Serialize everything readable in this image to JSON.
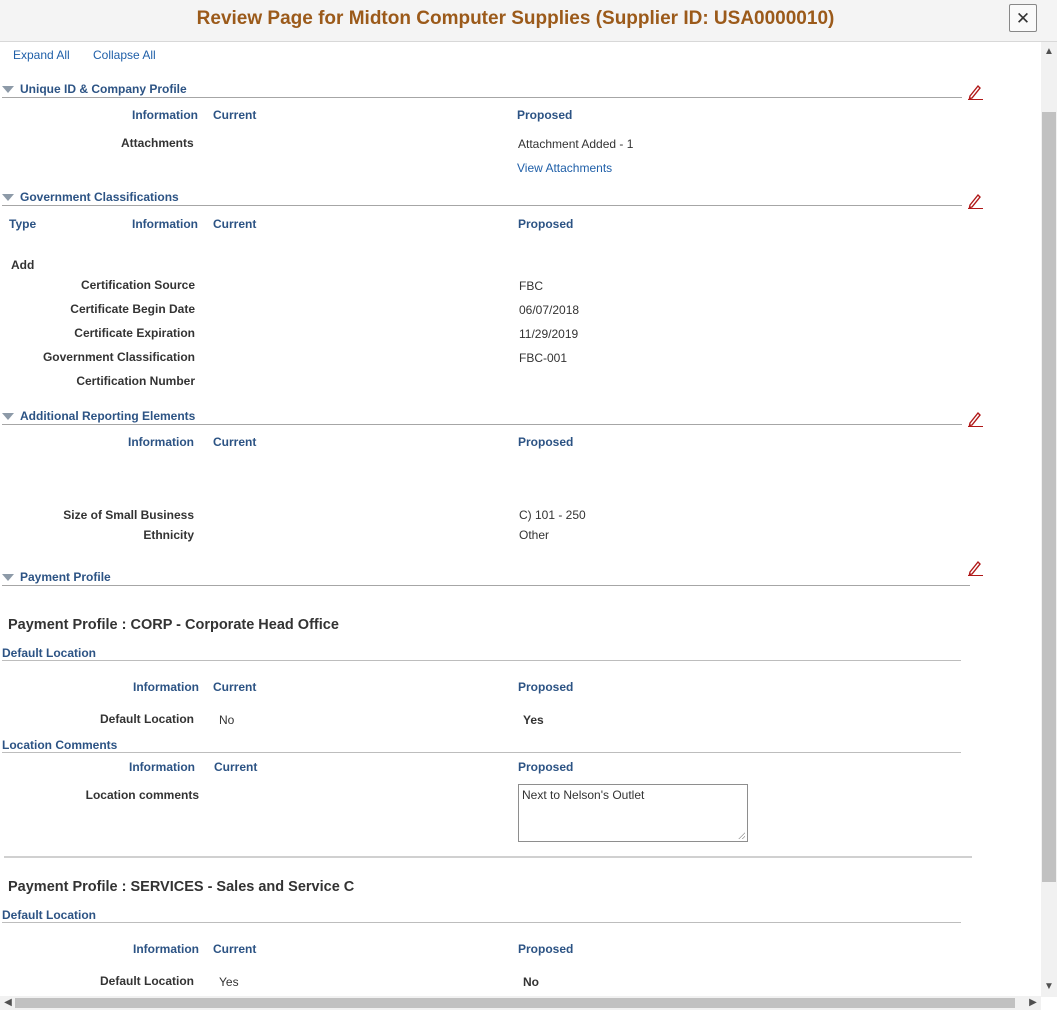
{
  "window": {
    "title": "Review Page for Midton Computer Supplies (Supplier ID: USA0000010)",
    "close_icon": "close-icon",
    "close_glyph": "✕"
  },
  "toolbar": {
    "expand_all": "Expand All",
    "collapse_all": "Collapse All"
  },
  "columns": {
    "type": "Type",
    "information": "Information",
    "current": "Current",
    "proposed": "Proposed"
  },
  "sections": {
    "unique_id": {
      "title": "Unique ID & Company Profile",
      "rows": [
        {
          "label": "Attachments",
          "current": "",
          "proposed": "Attachment Added - 1"
        }
      ],
      "view_attachments": "View Attachments"
    },
    "gov": {
      "title": "Government Classifications",
      "type_value": "Add",
      "rows": [
        {
          "label": "Certification Source",
          "current": "",
          "proposed": "FBC"
        },
        {
          "label": "Certificate Begin Date",
          "current": "",
          "proposed": "06/07/2018"
        },
        {
          "label": "Certificate Expiration",
          "current": "",
          "proposed": "11/29/2019"
        },
        {
          "label": "Government Classification",
          "current": "",
          "proposed": "FBC-001"
        },
        {
          "label": "Certification Number",
          "current": "",
          "proposed": ""
        }
      ]
    },
    "additional": {
      "title": "Additional Reporting Elements",
      "rows": [
        {
          "label": "Size of Small Business",
          "current": "",
          "proposed": "C) 101 - 250"
        },
        {
          "label": "Ethnicity",
          "current": "",
          "proposed": "Other"
        }
      ]
    },
    "payment": {
      "title": "Payment Profile",
      "profiles": [
        {
          "title": "Payment Profile : CORP - Corporate Head Office",
          "default_location_title": "Default Location",
          "default_location": {
            "label": "Default Location",
            "current": "No",
            "proposed": "Yes"
          },
          "location_comments_title": "Location Comments",
          "location_comments": {
            "label": "Location comments",
            "current": "",
            "proposed": "Next to Nelson's Outlet"
          }
        },
        {
          "title": "Payment Profile : SERVICES - Sales and Service C",
          "default_location_title": "Default Location",
          "default_location": {
            "label": "Default Location",
            "current": "Yes",
            "proposed": "No"
          }
        }
      ]
    }
  },
  "icons": {
    "section_toggle": "collapse-triangle-icon",
    "edit": "pencil-edit-icon"
  },
  "colors": {
    "title": "#9b5a1a",
    "header": "#2c5384",
    "link": "#1f5fa8"
  }
}
